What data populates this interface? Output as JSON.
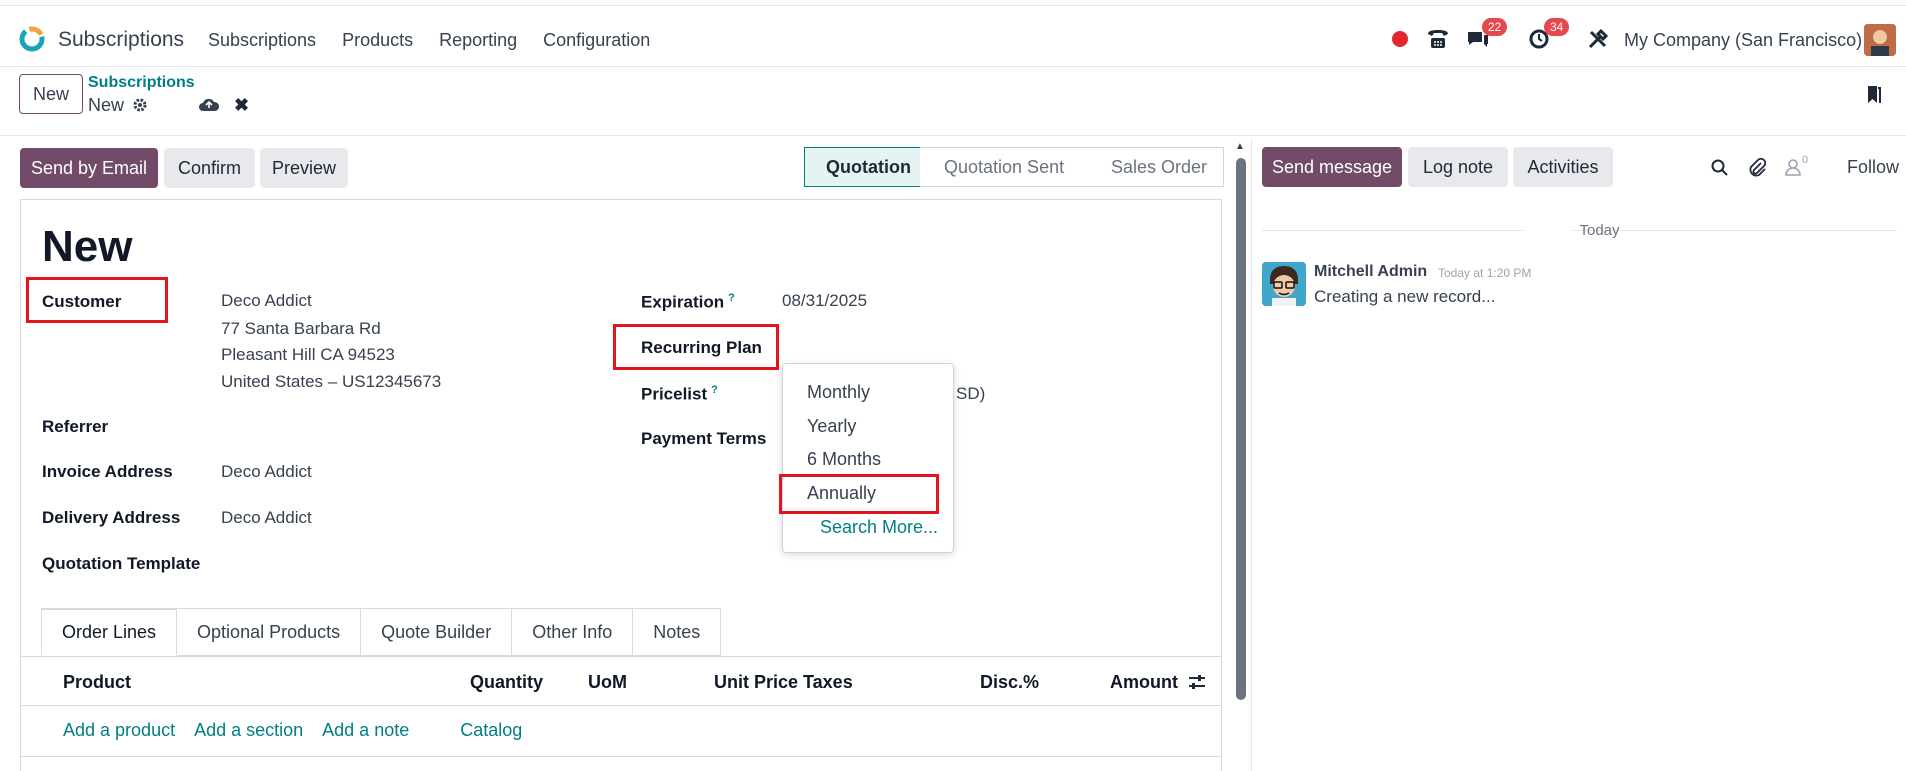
{
  "topbar": {
    "app_name": "Subscriptions",
    "menu": [
      "Subscriptions",
      "Products",
      "Reporting",
      "Configuration"
    ],
    "messages_count": "22",
    "activities_count": "34",
    "company": "My Company (San Francisco)"
  },
  "control": {
    "new_button": "New",
    "breadcrumb_parent": "Subscriptions",
    "breadcrumb_current": "New"
  },
  "actions": {
    "send_email": "Send by Email",
    "confirm": "Confirm",
    "preview": "Preview"
  },
  "statusbar": {
    "stages": [
      "Quotation",
      "Quotation Sent",
      "Sales Order"
    ],
    "active": "Quotation"
  },
  "form": {
    "title": "New",
    "customer_label": "Customer",
    "customer_name": "Deco Addict",
    "customer_address1": "77 Santa Barbara Rd",
    "customer_address2": "Pleasant Hill CA 94523",
    "customer_address3": "United States – US12345673",
    "referrer_label": "Referrer",
    "invoice_address_label": "Invoice Address",
    "invoice_address_value": "Deco Addict",
    "delivery_address_label": "Delivery Address",
    "delivery_address_value": "Deco Addict",
    "quotation_template_label": "Quotation Template",
    "expiration_label": "Expiration",
    "expiration_value": "08/31/2025",
    "recurring_plan_label": "Recurring Plan",
    "pricelist_label": "Pricelist",
    "pricelist_value_partial": "SD)",
    "payment_terms_label": "Payment Terms",
    "help_mark": "?"
  },
  "dropdown": {
    "options": [
      "Monthly",
      "Yearly",
      "6 Months",
      "Annually"
    ],
    "search_more": "Search More..."
  },
  "tabs": [
    "Order Lines",
    "Optional Products",
    "Quote Builder",
    "Other Info",
    "Notes"
  ],
  "table": {
    "headers": [
      "Product",
      "Quantity",
      "UoM",
      "Unit Price",
      "Taxes",
      "Disc.%",
      "Amount"
    ],
    "add_links": [
      "Add a product",
      "Add a section",
      "Add a note",
      "Catalog"
    ]
  },
  "chatter": {
    "send_message": "Send message",
    "log_note": "Log note",
    "activities": "Activities",
    "followers_count": "0",
    "follow": "Follow",
    "today": "Today",
    "author": "Mitchell Admin",
    "time": "Today at 1:20 PM",
    "message": "Creating a new record..."
  },
  "colors": {
    "primary": "#714b67",
    "link": "#017e84",
    "highlight": "#e3151c",
    "badge": "#e5484d"
  }
}
